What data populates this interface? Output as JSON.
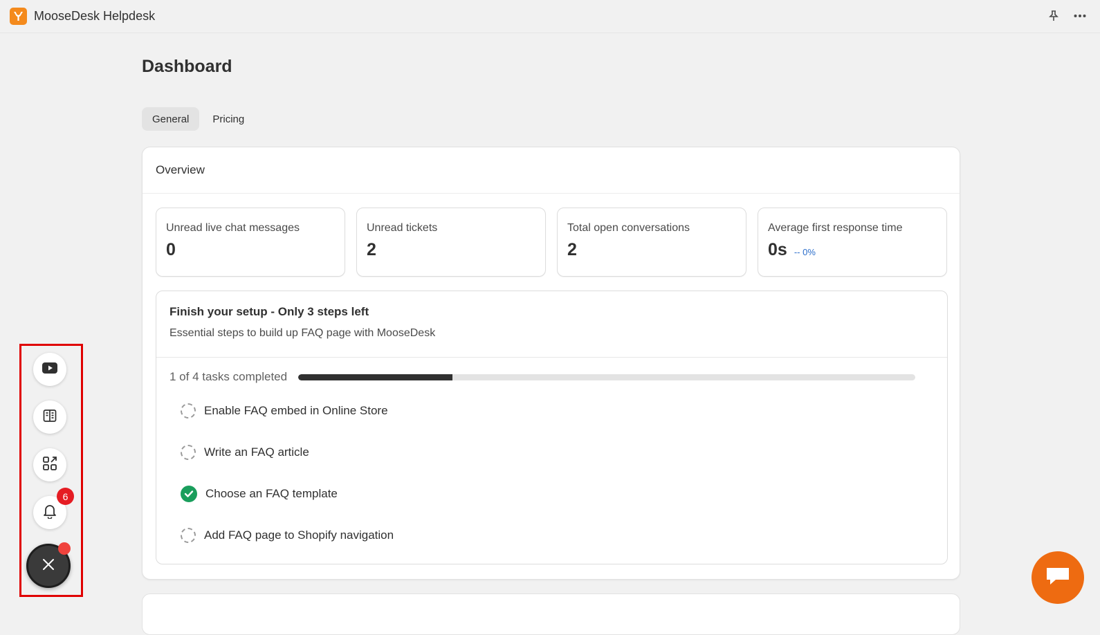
{
  "app": {
    "title": "MooseDesk Helpdesk"
  },
  "page": {
    "title": "Dashboard"
  },
  "tabs": [
    {
      "label": "General",
      "active": true
    },
    {
      "label": "Pricing",
      "active": false
    }
  ],
  "overview": {
    "title": "Overview",
    "stats": [
      {
        "label": "Unread live chat messages",
        "value": "0"
      },
      {
        "label": "Unread tickets",
        "value": "2"
      },
      {
        "label": "Total open conversations",
        "value": "2"
      },
      {
        "label": "Average first response time",
        "value": "0s",
        "delta": "-- 0%"
      }
    ]
  },
  "setup": {
    "title": "Finish your setup - Only 3 steps left",
    "subtitle": "Essential steps to build up FAQ page with MooseDesk",
    "progress_text": "1 of 4 tasks completed",
    "progress_fraction": 0.25,
    "tasks": [
      {
        "label": "Enable FAQ embed in Online Store",
        "done": false
      },
      {
        "label": "Write an FAQ article",
        "done": false
      },
      {
        "label": "Choose an FAQ template",
        "done": true
      },
      {
        "label": "Add FAQ page to Shopify navigation",
        "done": false
      }
    ]
  },
  "floating_menu": {
    "notification_count": "6"
  },
  "colors": {
    "brand_orange": "#f48a1c",
    "chat_orange": "#ee6b11",
    "success_green": "#1a9e5c",
    "highlight_red": "#e00000",
    "badge_red": "#e51c23",
    "delta_blue": "#2c6ecb"
  },
  "icons": {
    "logo": "moosedesk-logo-icon",
    "pin": "pin-icon",
    "more": "more-horizontal-icon",
    "youtube": "youtube-icon",
    "book": "book-icon",
    "apps": "apps-icon",
    "bell": "bell-icon",
    "close": "close-icon",
    "chat": "chat-icon"
  }
}
